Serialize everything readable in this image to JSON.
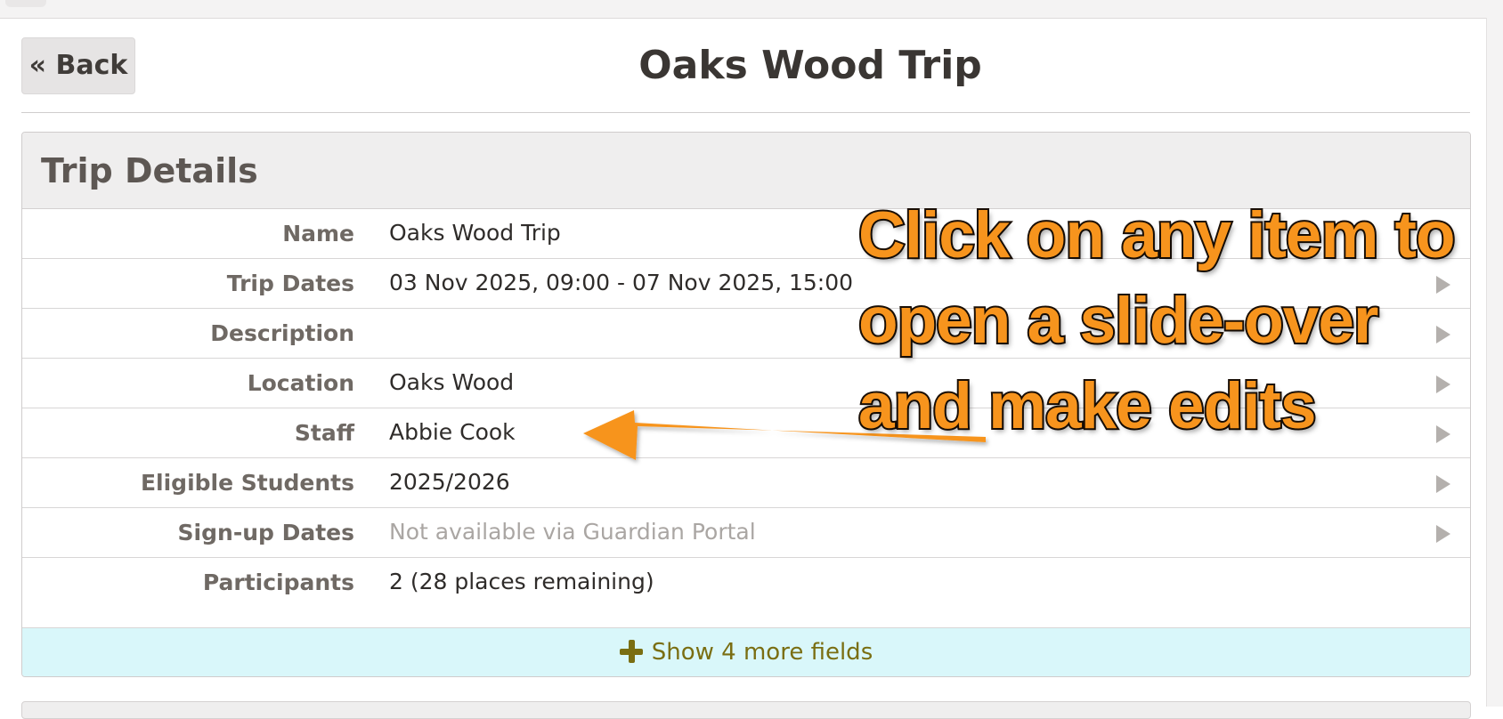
{
  "header": {
    "back_label": "« Back",
    "title": "Oaks Wood Trip"
  },
  "panel": {
    "title": "Trip Details",
    "rows": [
      {
        "label": "Name",
        "value": "Oaks Wood Trip",
        "muted": false,
        "has_arrow": false
      },
      {
        "label": "Trip Dates",
        "value": "03 Nov 2025, 09:00 - 07 Nov 2025, 15:00",
        "muted": false,
        "has_arrow": true
      },
      {
        "label": "Description",
        "value": "",
        "muted": false,
        "has_arrow": true
      },
      {
        "label": "Location",
        "value": "Oaks Wood",
        "muted": false,
        "has_arrow": true
      },
      {
        "label": "Staff",
        "value": "Abbie Cook",
        "muted": false,
        "has_arrow": true
      },
      {
        "label": "Eligible Students",
        "value": "2025/2026",
        "muted": false,
        "has_arrow": true
      },
      {
        "label": "Sign-up Dates",
        "value": "Not available via Guardian Portal",
        "muted": true,
        "has_arrow": true
      },
      {
        "label": "Participants",
        "value": "2 (28 places remaining)",
        "muted": false,
        "has_arrow": false
      }
    ],
    "show_more_label": "Show 4 more fields",
    "show_more_icon": "plus-icon"
  },
  "annotation": {
    "lines": [
      "Click on any item to",
      "open a slide-over",
      "and make edits"
    ],
    "text_color": "#f7941d",
    "arrow_color": "#f7941d",
    "arrow_icon": "arrow-left-icon"
  },
  "colors": {
    "show_more_bg": "#d9f7fa",
    "show_more_text": "#7a6e12",
    "muted_text": "#aaa6a3"
  }
}
